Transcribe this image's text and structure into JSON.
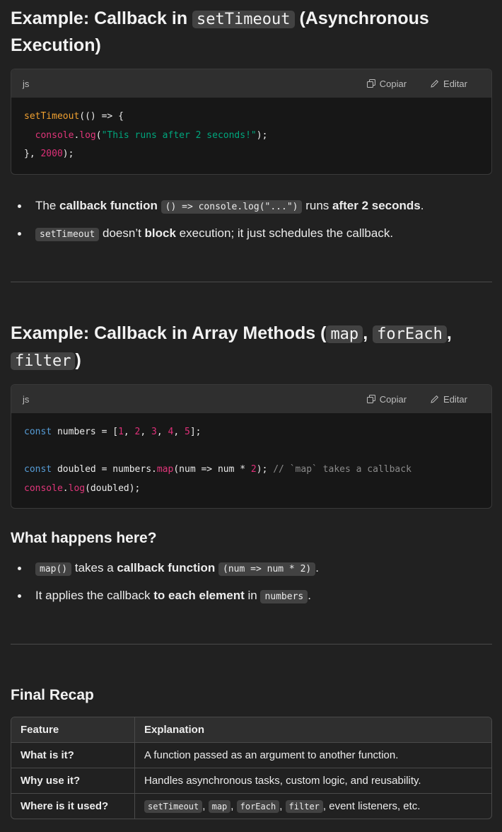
{
  "section1": {
    "title_prefix": "Example: Callback in ",
    "title_code": "setTimeout",
    "title_suffix": " (Asynchronous Execution)",
    "code": {
      "lang": "js",
      "copy_label": "Copiar",
      "edit_label": "Editar",
      "lines": [
        "setTimeout(() => {",
        "  console.log(\"This runs after 2 seconds!\");",
        "}, 2000);"
      ]
    },
    "bullets": [
      {
        "t1": "The ",
        "b1": "callback function",
        "c1": "() => console.log(\"...\")",
        "t2": " runs ",
        "b2": "after 2 seconds",
        "t3": "."
      },
      {
        "c1": "setTimeout",
        "t1": " doesn’t ",
        "b1": "block",
        "t2": " execution; it just schedules the callback."
      }
    ]
  },
  "section2": {
    "title_prefix": "Example: Callback in Array Methods (",
    "title_codes": [
      "map",
      "forEach",
      "filter"
    ],
    "title_sep": ", ",
    "title_suffix": ")",
    "code": {
      "lang": "js",
      "copy_label": "Copiar",
      "edit_label": "Editar",
      "lines": [
        "const numbers = [1, 2, 3, 4, 5];",
        "",
        "const doubled = numbers.map(num => num * 2); // `map` takes a callback",
        "console.log(doubled);"
      ]
    }
  },
  "section3": {
    "title": "What happens here?",
    "bullets": [
      {
        "c1": "map()",
        "t1": " takes a ",
        "b1": "callback function",
        "t2": " ",
        "c2": "(num => num * 2)",
        "t3": "."
      },
      {
        "t1": "It applies the callback ",
        "b1": "to each element",
        "t2": " in ",
        "c1": "numbers",
        "t3": "."
      }
    ]
  },
  "recap": {
    "title": "Final Recap",
    "headers": [
      "Feature",
      "Explanation"
    ],
    "rows": [
      {
        "feature": "What is it?",
        "explanation": "A function passed as an argument to another function."
      },
      {
        "feature": "Why use it?",
        "explanation": "Handles asynchronous tasks, custom logic, and reusability."
      },
      {
        "feature": "Where is it used?",
        "codes": [
          "setTimeout",
          "map",
          "forEach",
          "filter"
        ],
        "tail": ", event listeners, etc."
      }
    ]
  }
}
